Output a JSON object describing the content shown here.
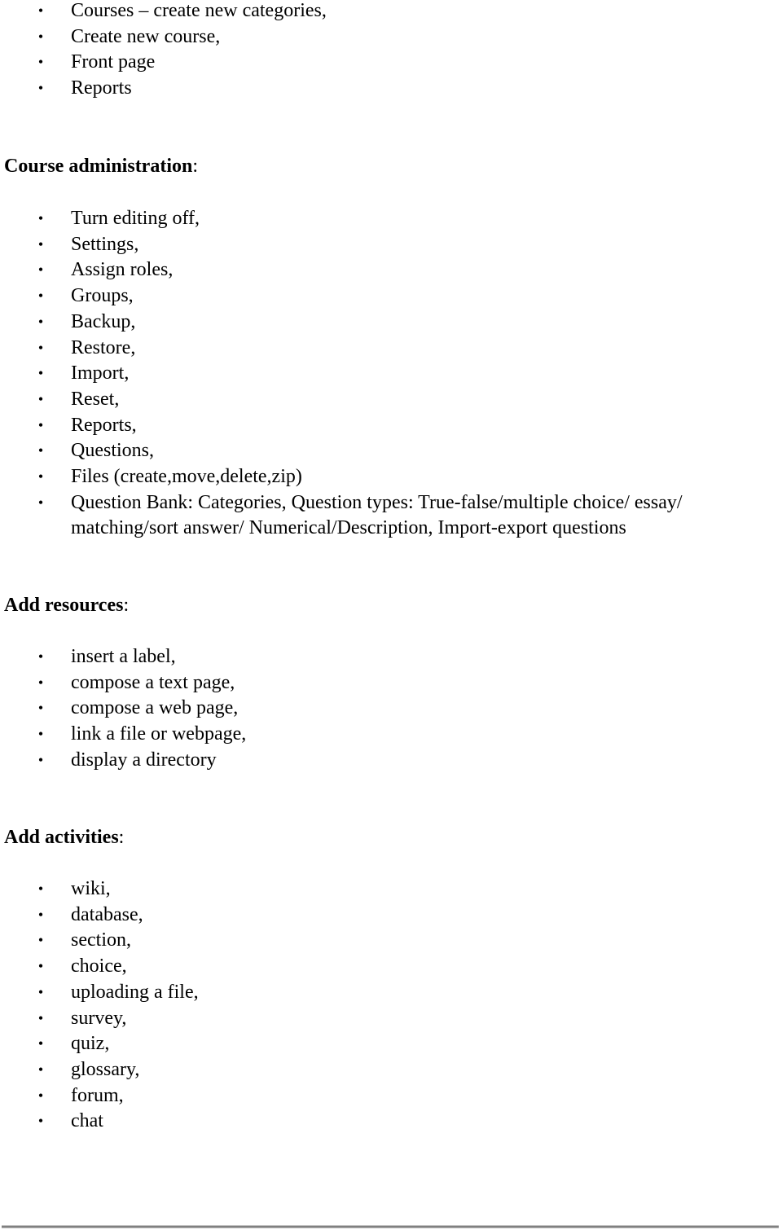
{
  "sections": [
    {
      "heading": null,
      "items": [
        "Courses – create new categories,",
        "Create new course,",
        "Front page",
        "Reports"
      ]
    },
    {
      "heading": "Course administration",
      "items": [
        "Turn editing off,",
        "Settings,",
        "Assign roles,",
        "Groups,",
        "Backup,",
        "Restore,",
        "Import,",
        "Reset,",
        "Reports,",
        "Questions,",
        "Files (create,move,delete,zip)",
        "Question Bank: Categories, Question types: True-false/multiple choice/ essay/ matching/sort answer/ Numerical/Description, Import-export questions"
      ]
    },
    {
      "heading": "Add resources",
      "items": [
        "insert a label,",
        "compose a text page,",
        "compose a web page,",
        "link a file or webpage,",
        "display a directory"
      ]
    },
    {
      "heading": "Add activities",
      "items": [
        "wiki,",
        "database,",
        "section,",
        "choice,",
        "uploading a file,",
        "survey,",
        "quiz,",
        "glossary,",
        "forum,",
        "chat"
      ]
    }
  ],
  "heading_suffix": ":",
  "bullet_glyph": "•"
}
